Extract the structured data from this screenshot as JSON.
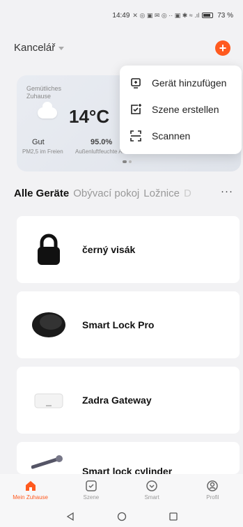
{
  "status": {
    "time": "14:49",
    "battery": "73 %"
  },
  "header": {
    "home_name": "Kancelář"
  },
  "weather": {
    "home_label": "Gemütliches Zuhause",
    "temperature": "14°C",
    "air_quality": "Gut",
    "humidity": "95.0%",
    "air_label": "PM2,5 im Freien",
    "humidity_label": "Außenluftfeuchte Außenluftdruck"
  },
  "popup_menu": [
    {
      "label": "Gerät hinzufügen",
      "icon": "add-device-icon"
    },
    {
      "label": "Szene erstellen",
      "icon": "create-scene-icon"
    },
    {
      "label": "Scannen",
      "icon": "scan-icon"
    }
  ],
  "room_tabs": [
    "Alle Geräte",
    "Obývací pokoj",
    "Ložnice",
    "D"
  ],
  "devices": [
    {
      "name": "černý visák",
      "icon": "padlock-icon"
    },
    {
      "name": "Smart Lock Pro",
      "icon": "smart-lock-icon"
    },
    {
      "name": "Zadra Gateway",
      "icon": "gateway-icon"
    },
    {
      "name": "Smart lock cylinder",
      "icon": "cylinder-icon"
    }
  ],
  "bottom_tabs": [
    {
      "label": "Mein Zuhause",
      "icon": "home-icon"
    },
    {
      "label": "Szene",
      "icon": "scene-icon"
    },
    {
      "label": "Smart",
      "icon": "smart-icon"
    },
    {
      "label": "Profil",
      "icon": "profile-icon"
    }
  ],
  "colors": {
    "accent": "#ff5a1f"
  }
}
